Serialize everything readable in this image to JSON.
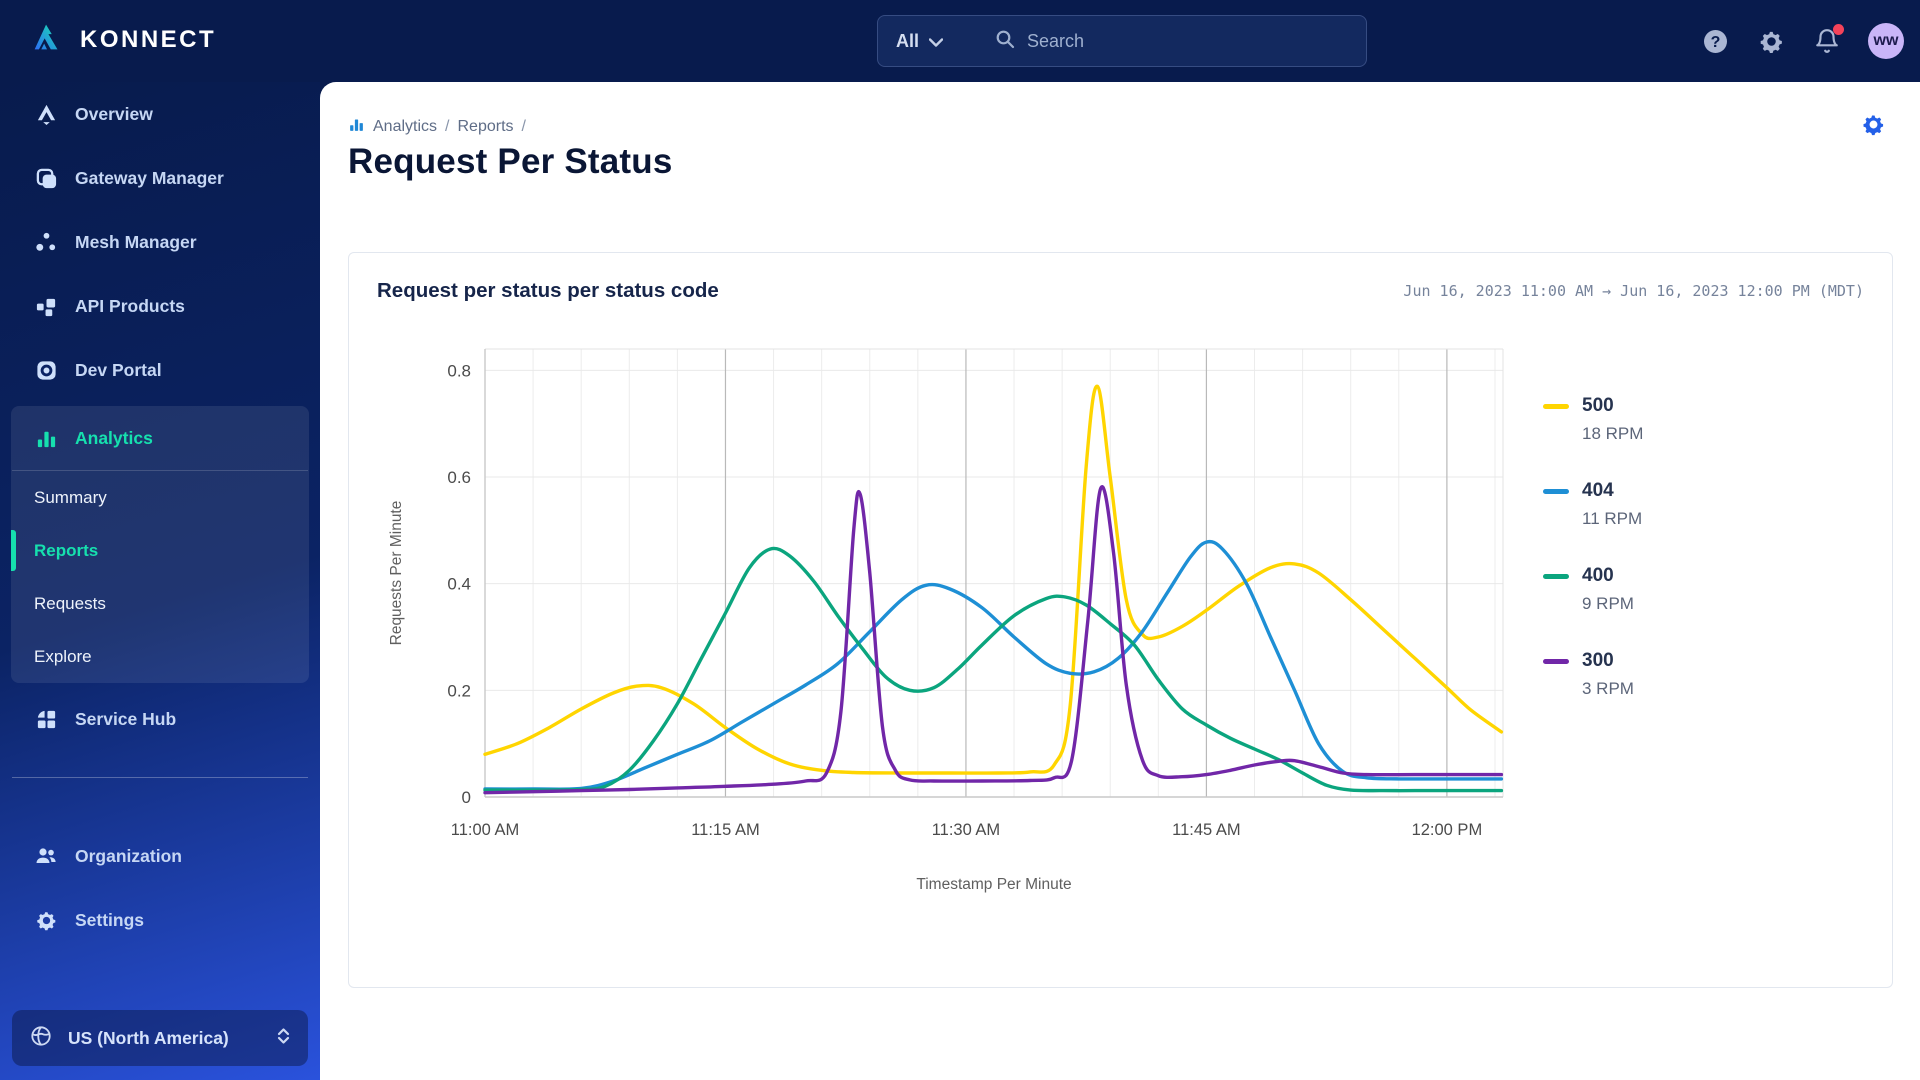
{
  "brand": {
    "name": "KONNECT"
  },
  "topbar": {
    "scope_label": "All",
    "search_placeholder": "Search",
    "avatar_initials": "ww"
  },
  "sidebar": {
    "items": [
      {
        "label": "Overview",
        "icon": "overview-knot-icon"
      },
      {
        "label": "Gateway Manager",
        "icon": "stacked-squares-icon"
      },
      {
        "label": "Mesh Manager",
        "icon": "mesh-dots-icon"
      },
      {
        "label": "API Products",
        "icon": "blocks-icon"
      },
      {
        "label": "Dev Portal",
        "icon": "portal-icon"
      }
    ],
    "analytics_group": {
      "label": "Analytics",
      "children": [
        {
          "label": "Summary",
          "active": false
        },
        {
          "label": "Reports",
          "active": true
        },
        {
          "label": "Requests",
          "active": false
        },
        {
          "label": "Explore",
          "active": false
        }
      ]
    },
    "service_hub": {
      "label": "Service Hub",
      "icon": "grid-icon"
    },
    "footer_items": [
      {
        "label": "Organization",
        "icon": "people-icon"
      },
      {
        "label": "Settings",
        "icon": "gear-icon"
      }
    ],
    "region_selector": {
      "label": "US (North America)"
    }
  },
  "breadcrumb": {
    "part1": "Analytics",
    "sep1": "/",
    "part2": "Reports",
    "sep2": "/"
  },
  "page": {
    "title": "Request Per Status"
  },
  "card": {
    "title": "Request per status per status code",
    "time_range": "Jun 16, 2023 11:00 AM → Jun 16, 2023 12:00 PM (MDT)"
  },
  "chart_data": {
    "type": "line",
    "title": "Request per status per status code",
    "xlabel": "Timestamp Per Minute",
    "ylabel": "Requests Per Minute",
    "x_unit": "minutes after 11:00 AM, Jun 16 2023 (MDT)",
    "xlim": [
      0,
      63.5
    ],
    "ylim": [
      0,
      0.84
    ],
    "grid": true,
    "minor_grid_every_minutes": 3,
    "major_grid_minutes": [
      15,
      30,
      45,
      60
    ],
    "x_ticks": [
      {
        "m": 0,
        "label": "11:00 AM"
      },
      {
        "m": 15,
        "label": "11:15 AM"
      },
      {
        "m": 30,
        "label": "11:30 AM"
      },
      {
        "m": 45,
        "label": "11:45 AM"
      },
      {
        "m": 60,
        "label": "12:00 PM"
      }
    ],
    "y_ticks": [
      {
        "v": 0,
        "label": "0"
      },
      {
        "v": 0.2,
        "label": "0.2"
      },
      {
        "v": 0.4,
        "label": "0.4"
      },
      {
        "v": 0.6,
        "label": "0.6"
      },
      {
        "v": 0.8,
        "label": "0.8"
      }
    ],
    "legend_position": "right",
    "series": [
      {
        "name": "500",
        "rpm": "18 RPM",
        "color": "#FFD500",
        "points": [
          [
            0,
            0.08
          ],
          [
            2,
            0.1
          ],
          [
            4,
            0.13
          ],
          [
            6,
            0.165
          ],
          [
            8,
            0.195
          ],
          [
            9.5,
            0.208
          ],
          [
            11,
            0.205
          ],
          [
            13,
            0.175
          ],
          [
            15,
            0.13
          ],
          [
            17,
            0.09
          ],
          [
            19,
            0.062
          ],
          [
            21,
            0.05
          ],
          [
            23,
            0.046
          ],
          [
            26,
            0.045
          ],
          [
            29,
            0.045
          ],
          [
            32,
            0.045
          ],
          [
            34,
            0.047
          ],
          [
            35.5,
            0.06
          ],
          [
            36.5,
            0.17
          ],
          [
            37.5,
            0.62
          ],
          [
            38.2,
            0.77
          ],
          [
            39,
            0.6
          ],
          [
            40,
            0.37
          ],
          [
            41,
            0.305
          ],
          [
            42,
            0.3
          ],
          [
            43.5,
            0.32
          ],
          [
            45,
            0.35
          ],
          [
            47,
            0.395
          ],
          [
            49,
            0.43
          ],
          [
            50.5,
            0.437
          ],
          [
            52,
            0.42
          ],
          [
            54,
            0.37
          ],
          [
            56,
            0.315
          ],
          [
            58,
            0.26
          ],
          [
            60,
            0.205
          ],
          [
            61.5,
            0.163
          ],
          [
            63.4,
            0.122
          ]
        ]
      },
      {
        "name": "404",
        "rpm": "11 RPM",
        "color": "#1E8FD5",
        "points": [
          [
            0,
            0.015
          ],
          [
            3,
            0.015
          ],
          [
            6,
            0.016
          ],
          [
            8,
            0.03
          ],
          [
            10,
            0.055
          ],
          [
            12,
            0.08
          ],
          [
            14,
            0.105
          ],
          [
            16,
            0.14
          ],
          [
            18,
            0.175
          ],
          [
            20,
            0.21
          ],
          [
            22,
            0.25
          ],
          [
            24,
            0.31
          ],
          [
            26,
            0.37
          ],
          [
            27.5,
            0.397
          ],
          [
            29,
            0.39
          ],
          [
            31,
            0.355
          ],
          [
            33,
            0.3
          ],
          [
            35,
            0.25
          ],
          [
            36.5,
            0.232
          ],
          [
            38,
            0.235
          ],
          [
            39.5,
            0.26
          ],
          [
            41,
            0.31
          ],
          [
            42.5,
            0.38
          ],
          [
            44,
            0.45
          ],
          [
            45,
            0.478
          ],
          [
            46,
            0.465
          ],
          [
            47.5,
            0.4
          ],
          [
            49,
            0.3
          ],
          [
            50.5,
            0.2
          ],
          [
            52,
            0.1
          ],
          [
            53.5,
            0.048
          ],
          [
            55,
            0.036
          ],
          [
            57,
            0.034
          ],
          [
            59,
            0.034
          ],
          [
            61,
            0.034
          ],
          [
            63.4,
            0.034
          ]
        ]
      },
      {
        "name": "400",
        "rpm": "9 RPM",
        "color": "#0BA57E",
        "points": [
          [
            0,
            0.013
          ],
          [
            3,
            0.013
          ],
          [
            6,
            0.014
          ],
          [
            7.5,
            0.02
          ],
          [
            9,
            0.05
          ],
          [
            10.5,
            0.105
          ],
          [
            12,
            0.175
          ],
          [
            13.5,
            0.26
          ],
          [
            15,
            0.345
          ],
          [
            16.5,
            0.43
          ],
          [
            17.8,
            0.465
          ],
          [
            19,
            0.452
          ],
          [
            20.5,
            0.405
          ],
          [
            22,
            0.34
          ],
          [
            23.5,
            0.28
          ],
          [
            25,
            0.225
          ],
          [
            26.5,
            0.2
          ],
          [
            28,
            0.205
          ],
          [
            29.5,
            0.24
          ],
          [
            31,
            0.285
          ],
          [
            33,
            0.34
          ],
          [
            35,
            0.372
          ],
          [
            36.2,
            0.375
          ],
          [
            37.5,
            0.36
          ],
          [
            39,
            0.325
          ],
          [
            40.5,
            0.285
          ],
          [
            42,
            0.22
          ],
          [
            43.5,
            0.165
          ],
          [
            45,
            0.135
          ],
          [
            46.5,
            0.11
          ],
          [
            48,
            0.09
          ],
          [
            49.5,
            0.07
          ],
          [
            51,
            0.045
          ],
          [
            52.5,
            0.022
          ],
          [
            54,
            0.013
          ],
          [
            56,
            0.012
          ],
          [
            58,
            0.012
          ],
          [
            60,
            0.012
          ],
          [
            63.4,
            0.012
          ]
        ]
      },
      {
        "name": "300",
        "rpm": "3 RPM",
        "color": "#7127A8",
        "points": [
          [
            0,
            0.008
          ],
          [
            3,
            0.01
          ],
          [
            6,
            0.012
          ],
          [
            9,
            0.014
          ],
          [
            12,
            0.017
          ],
          [
            15,
            0.02
          ],
          [
            18,
            0.024
          ],
          [
            20,
            0.03
          ],
          [
            21.3,
            0.045
          ],
          [
            22.2,
            0.16
          ],
          [
            23,
            0.5
          ],
          [
            23.4,
            0.568
          ],
          [
            24,
            0.42
          ],
          [
            24.8,
            0.13
          ],
          [
            25.6,
            0.05
          ],
          [
            26.5,
            0.032
          ],
          [
            28,
            0.03
          ],
          [
            31,
            0.03
          ],
          [
            34,
            0.031
          ],
          [
            35.5,
            0.036
          ],
          [
            36.6,
            0.07
          ],
          [
            37.6,
            0.33
          ],
          [
            38.4,
            0.578
          ],
          [
            39.2,
            0.46
          ],
          [
            40,
            0.21
          ],
          [
            41,
            0.07
          ],
          [
            42,
            0.04
          ],
          [
            43.5,
            0.038
          ],
          [
            45,
            0.042
          ],
          [
            46.5,
            0.05
          ],
          [
            48,
            0.06
          ],
          [
            49.5,
            0.067
          ],
          [
            50.5,
            0.068
          ],
          [
            52,
            0.057
          ],
          [
            53.5,
            0.045
          ],
          [
            55,
            0.042
          ],
          [
            58,
            0.042
          ],
          [
            61,
            0.042
          ],
          [
            63.4,
            0.042
          ]
        ]
      }
    ]
  }
}
